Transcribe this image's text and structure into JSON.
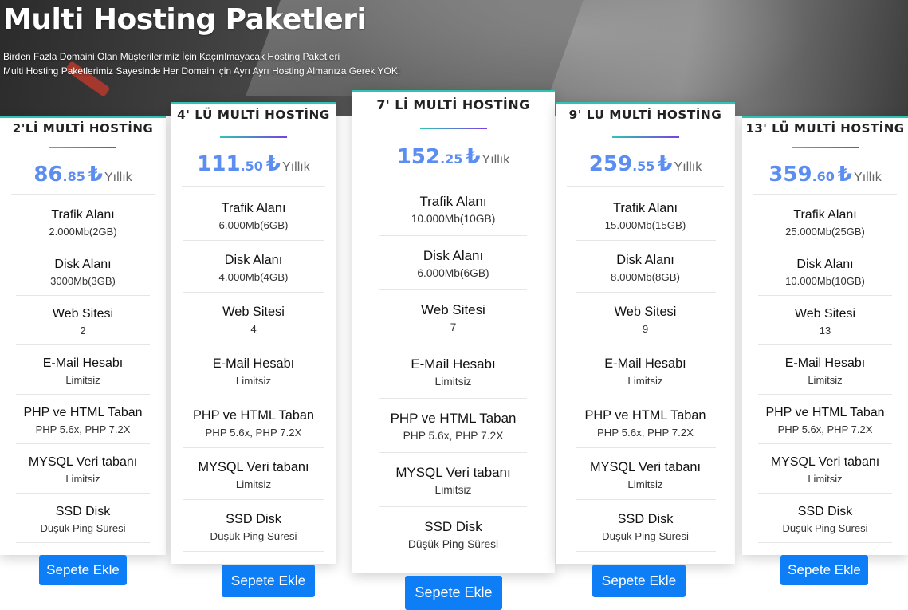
{
  "hero": {
    "title": "Multi Hosting Paketleri",
    "subtitle_line1": "Birden Fazla Domaini Olan Müşterilerimiz İçin Kaçırılmayacak Hosting Paketleri",
    "subtitle_line2": "Multi Hosting Paketlerimiz Sayesinde Her Domain için Ayrı Ayrı Hosting Almanıza Gerek YOK!"
  },
  "feature_labels": [
    "Trafik Alanı",
    "Disk Alanı",
    "Web Sitesi",
    "E-Mail Hesabı",
    "PHP ve HTML Taban",
    "MYSQL Veri tabanı",
    "SSD Disk"
  ],
  "plans": [
    {
      "title": "2'Lİ MULTİ HOSTİNG",
      "price_int": "86",
      "price_dec": ".85",
      "currency": "₺",
      "period": "Yıllık",
      "values": [
        "2.000Mb(2GB)",
        "3000Mb(3GB)",
        "2",
        "Limitsiz",
        "PHP 5.6x, PHP 7.2X",
        "Limitsiz",
        "Düşük Ping Süresi"
      ],
      "button": "Sepete Ekle"
    },
    {
      "title": "4' LÜ MULTİ HOSTİNG",
      "price_int": "111",
      "price_dec": ".50",
      "currency": "₺",
      "period": "Yıllık",
      "values": [
        "6.000Mb(6GB)",
        "4.000Mb(4GB)",
        "4",
        "Limitsiz",
        "PHP 5.6x, PHP 7.2X",
        "Limitsiz",
        "Düşük Ping Süresi"
      ],
      "button": "Sepete Ekle"
    },
    {
      "title": "7' Lİ MULTİ HOSTİNG",
      "price_int": "152",
      "price_dec": ".25",
      "currency": "₺",
      "period": "Yıllık",
      "values": [
        "10.000Mb(10GB)",
        "6.000Mb(6GB)",
        "7",
        "Limitsiz",
        "PHP 5.6x, PHP 7.2X",
        "Limitsiz",
        "Düşük Ping Süresi"
      ],
      "button": "Sepete Ekle"
    },
    {
      "title": "9' LU MULTİ HOSTİNG",
      "price_int": "259",
      "price_dec": ".55",
      "currency": "₺",
      "period": "Yıllık",
      "values": [
        "15.000Mb(15GB)",
        "8.000Mb(8GB)",
        "9",
        "Limitsiz",
        "PHP 5.6x, PHP 7.2X",
        "Limitsiz",
        "Düşük Ping Süresi"
      ],
      "button": "Sepete Ekle"
    },
    {
      "title": "13' LÜ MULTİ HOSTİNG",
      "price_int": "359",
      "price_dec": ".60",
      "currency": "₺",
      "period": "Yıllık",
      "values": [
        "25.000Mb(25GB)",
        "10.000Mb(10GB)",
        "13",
        "Limitsiz",
        "PHP 5.6x, PHP 7.2X",
        "Limitsiz",
        "Düşük Ping Süresi"
      ],
      "button": "Sepete Ekle"
    }
  ],
  "colors": {
    "accent": "#0d7ef5",
    "price": "#5b8ef0",
    "border_top": "#2fc4b2"
  }
}
